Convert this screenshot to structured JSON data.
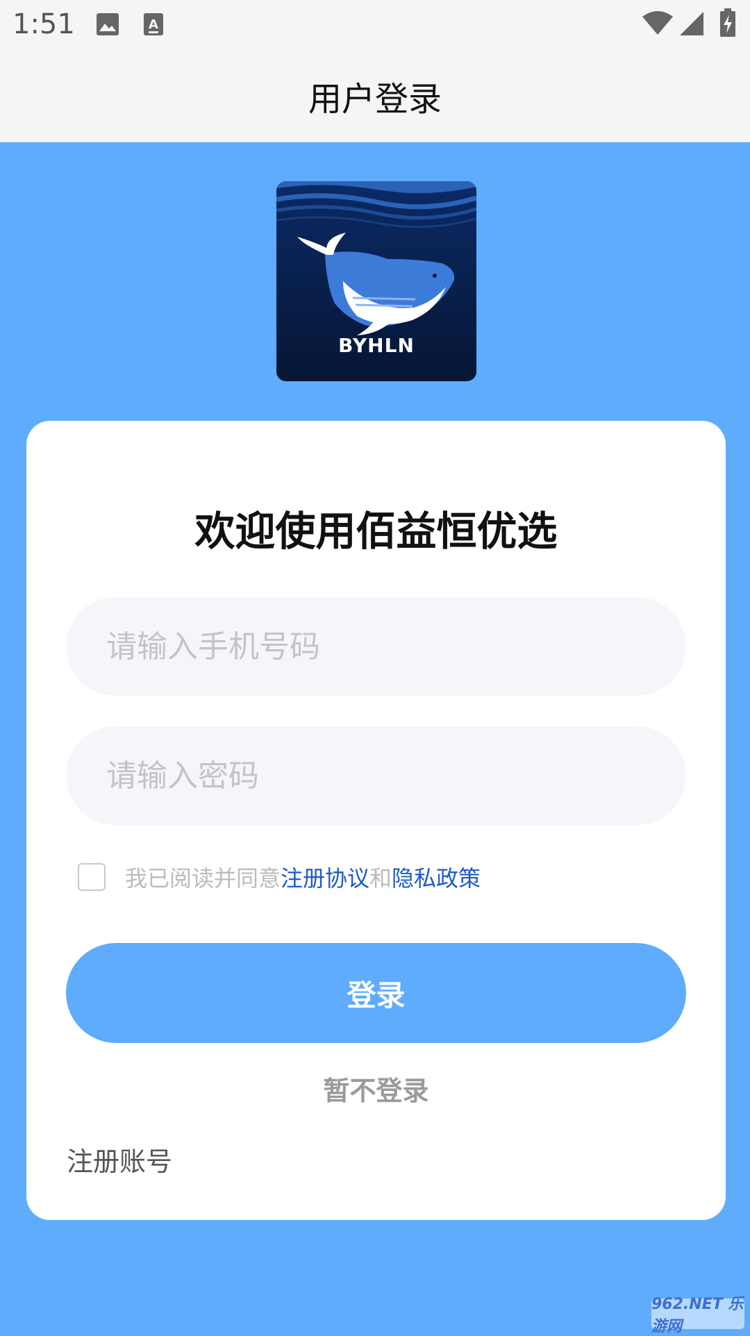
{
  "status_bar": {
    "time": "1:51",
    "icons": [
      "image-icon",
      "keyboard-a-icon",
      "wifi-icon",
      "signal-icon",
      "battery-charging-icon"
    ]
  },
  "header": {
    "title": "用户登录"
  },
  "logo": {
    "text": "BYHLN"
  },
  "card": {
    "welcome": "欢迎使用佰益恒优选",
    "phone_placeholder": "请输入手机号码",
    "password_placeholder": "请输入密码",
    "agree_prefix": "我已阅读并同意",
    "agree_link1": "注册协议",
    "agree_and": "和",
    "agree_link2": "隐私政策",
    "login_label": "登录",
    "skip_label": "暂不登录",
    "register_label": "注册账号"
  },
  "watermark": {
    "text": "962.NET 乐游网"
  },
  "colors": {
    "accent": "#5eacfb",
    "link": "#1e5bc6",
    "field_bg": "#f4f6f9"
  }
}
